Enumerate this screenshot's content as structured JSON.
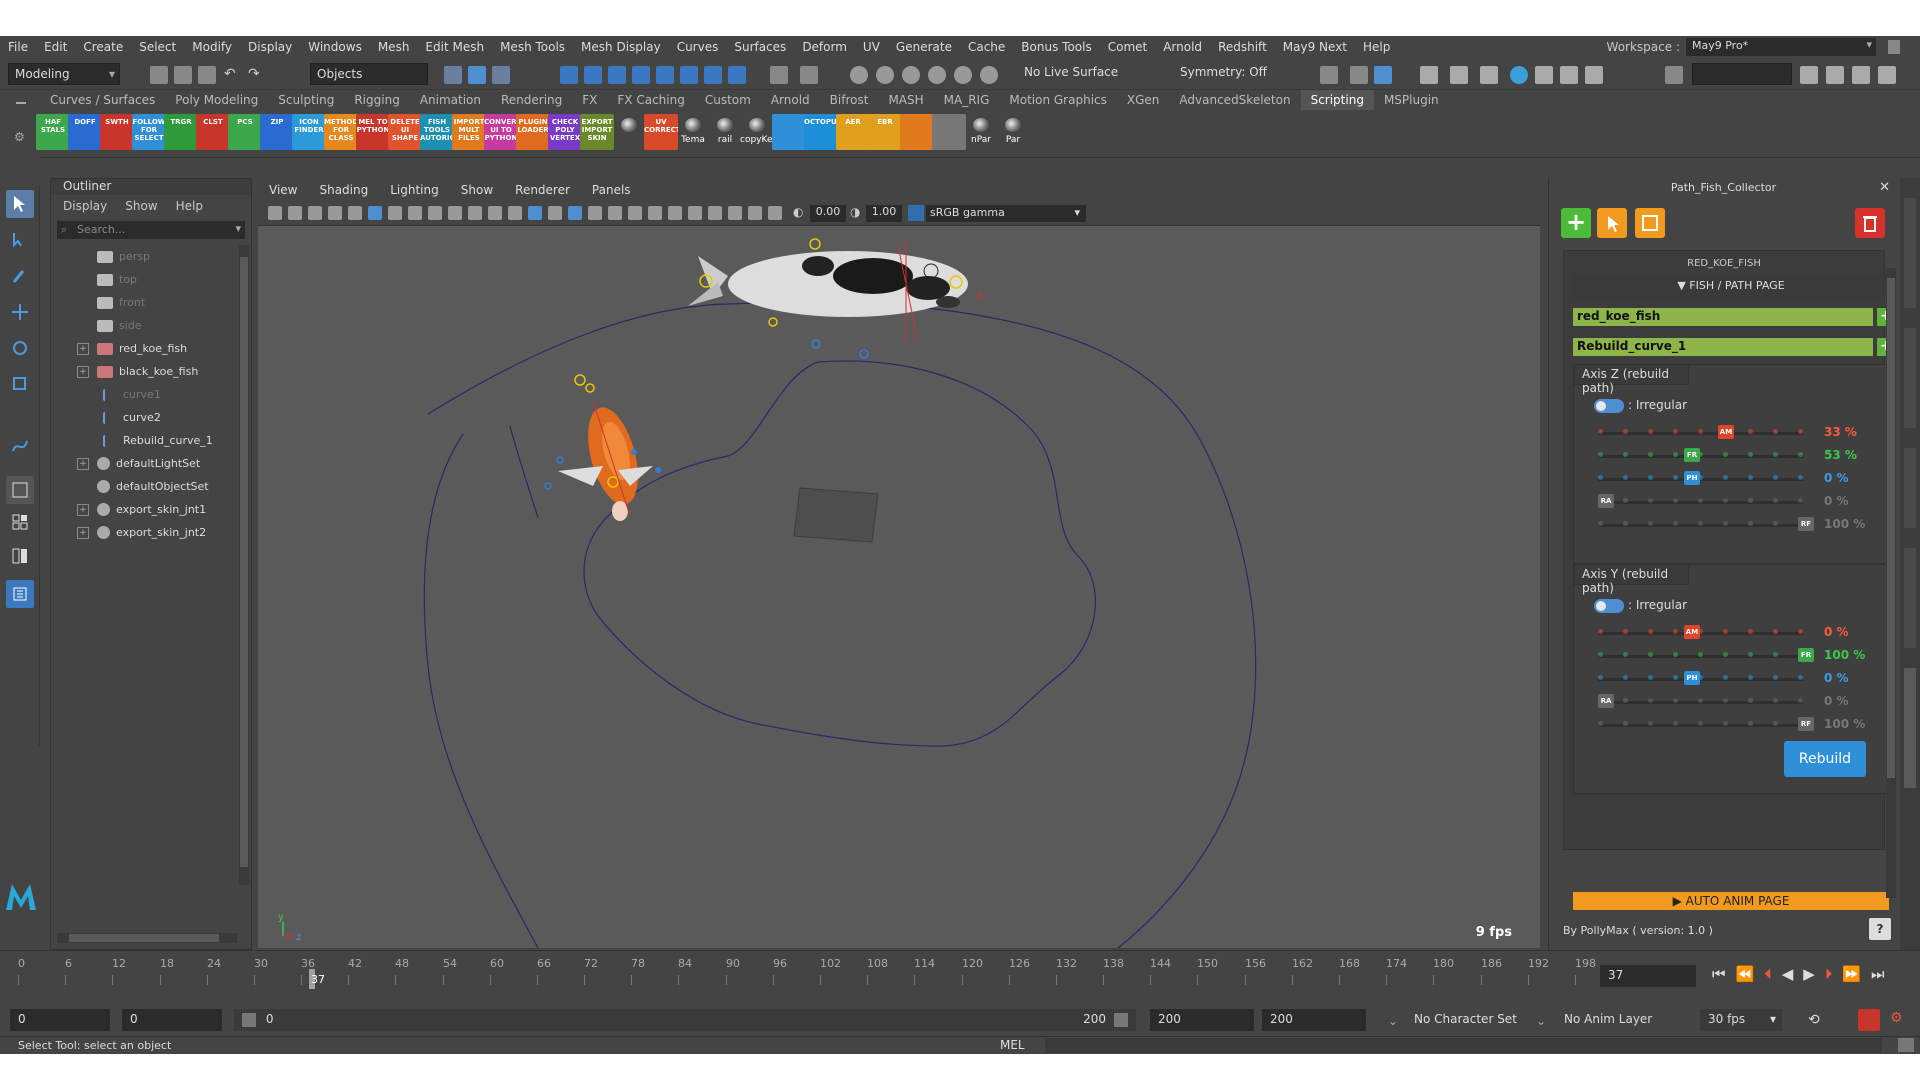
{
  "menubar": {
    "items": [
      "File",
      "Edit",
      "Create",
      "Select",
      "Modify",
      "Display",
      "Windows",
      "Mesh",
      "Edit Mesh",
      "Mesh Tools",
      "Mesh Display",
      "Curves",
      "Surfaces",
      "Deform",
      "UV",
      "Generate",
      "Cache",
      "Bonus Tools",
      "Comet",
      "Arnold",
      "Redshift",
      "May9 Next",
      "Help"
    ],
    "workspace_label": "Workspace :",
    "workspace_value": "May9 Pro*"
  },
  "status_line": {
    "mode": "Modeling",
    "selection": "Objects",
    "live_surface": "No Live Surface",
    "symmetry": "Symmetry: Off"
  },
  "shelf": {
    "tabs": [
      "Curves / Surfaces",
      "Poly Modeling",
      "Sculpting",
      "Rigging",
      "Animation",
      "Rendering",
      "FX",
      "FX Caching",
      "Custom",
      "Arnold",
      "Bifrost",
      "MASH",
      "MA_RIG",
      "Motion Graphics",
      "XGen",
      "AdvancedSkeleton",
      "Scripting",
      "MSPlugin"
    ],
    "active_tab": "Scripting",
    "buttons": [
      {
        "label": "HAF STALS",
        "color": "#3da84b"
      },
      {
        "label": "DOFF",
        "color": "#2a6bd1"
      },
      {
        "label": "SWTH",
        "color": "#c8352b"
      },
      {
        "label": "FOLLOW FOR SELECT",
        "color": "#2f8fd8"
      },
      {
        "label": "TRGR",
        "color": "#2f9a3a"
      },
      {
        "label": "CLST",
        "color": "#c8352b"
      },
      {
        "label": "PCS",
        "color": "#3da84b"
      },
      {
        "label": "ZIP",
        "color": "#2a6bd1"
      },
      {
        "label": "ICON FINDER",
        "color": "#2a9bd8"
      },
      {
        "label": "METHOD FOR CLASS",
        "color": "#e48a1d"
      },
      {
        "label": "MEL TO PYTHON",
        "color": "#c8352b"
      },
      {
        "label": "DELETE UI SHAPE",
        "color": "#e0532b"
      },
      {
        "label": "FISH TOOLS AUTORIG",
        "color": "#1d8fb3"
      },
      {
        "label": "IMPORT MULT FILES",
        "color": "#e07a1d"
      },
      {
        "label": "CONVERT UI TO PYTHON",
        "color": "#c83aa0"
      },
      {
        "label": "PLUGIN LOADER",
        "color": "#e06a1d"
      },
      {
        "label": "CHECK POLY VERTEX",
        "color": "#7a3ac8"
      },
      {
        "label": "EXPORT IMPORT SKIN",
        "color": "#6a8a2a"
      },
      {
        "label": "",
        "color": "ball"
      },
      {
        "label": "UV CORRECT",
        "color": "#d84a2a"
      },
      {
        "label": "Tema",
        "color": "ball"
      },
      {
        "label": "rail",
        "color": "ball"
      },
      {
        "label": "copyKey",
        "color": "ball"
      },
      {
        "label": "",
        "color": "#2f8fd8"
      },
      {
        "label": "OCTOPUS",
        "color": "#1d8fd8"
      },
      {
        "label": "AER",
        "color": "#e0a01d"
      },
      {
        "label": "EBR",
        "color": "#e0a01d"
      },
      {
        "label": "",
        "color": "#e07a1d"
      },
      {
        "label": "",
        "color": "#777"
      },
      {
        "label": "nPar",
        "color": "ball"
      },
      {
        "label": "Par",
        "color": "ball"
      }
    ]
  },
  "outliner": {
    "title": "Outliner",
    "menu": [
      "Display",
      "Show",
      "Help"
    ],
    "search_placeholder": "Search...",
    "items": [
      {
        "label": "persp",
        "icon": "camera-icon",
        "dim": true,
        "expandable": false
      },
      {
        "label": "top",
        "icon": "camera-icon",
        "dim": true,
        "expandable": false
      },
      {
        "label": "front",
        "icon": "camera-icon",
        "dim": true,
        "expandable": false
      },
      {
        "label": "side",
        "icon": "camera-icon",
        "dim": true,
        "expandable": false
      },
      {
        "label": "red_koe_fish",
        "icon": "mesh-icon",
        "dim": false,
        "expandable": true
      },
      {
        "label": "black_koe_fish",
        "icon": "mesh-icon",
        "dim": false,
        "expandable": true
      },
      {
        "label": "curve1",
        "icon": "curve-icon",
        "dim": true,
        "expandable": false
      },
      {
        "label": "curve2",
        "icon": "curve-icon",
        "dim": false,
        "expandable": false
      },
      {
        "label": "Rebuild_curve_1",
        "icon": "curve-icon",
        "dim": false,
        "expandable": false
      },
      {
        "label": "defaultLightSet",
        "icon": "set-icon",
        "dim": false,
        "expandable": true
      },
      {
        "label": "defaultObjectSet",
        "icon": "set-icon",
        "dim": false,
        "expandable": false
      },
      {
        "label": "export_skin_jnt1",
        "icon": "set-icon",
        "dim": false,
        "expandable": true
      },
      {
        "label": "export_skin_jnt2",
        "icon": "set-icon",
        "dim": false,
        "expandable": true
      }
    ]
  },
  "viewport": {
    "menu": [
      "View",
      "Shading",
      "Lighting",
      "Show",
      "Renderer",
      "Panels"
    ],
    "exposure": "0.00",
    "gamma": "1.00",
    "color_space": "sRGB gamma",
    "fps": "9 fps"
  },
  "fish_panel": {
    "title": "Path_Fish_Collector",
    "section_name": "RED_KOE_FISH",
    "page_label": "▼ FISH / PATH PAGE",
    "fish_name": "red_koe_fish",
    "curve_name": "Rebuild_curve_1",
    "axis_z": {
      "title": "Axis Z (rebuild path)",
      "mode": ": Irregular",
      "sliders": [
        {
          "tag": "AM",
          "tag_color": "#e0452b",
          "value": "33 %",
          "value_color": "#ff5a3a",
          "pos": 0.6
        },
        {
          "tag": "FR",
          "tag_color": "#3aa84b",
          "value": "53 %",
          "value_color": "#3ac84b",
          "pos": 0.43
        },
        {
          "tag": "PH",
          "tag_color": "#2f8fd8",
          "value": "0 %",
          "value_color": "#3a9be8",
          "pos": 0.43
        },
        {
          "tag": "RA",
          "tag_color": "#666",
          "value": "0 %",
          "value_color": "#777",
          "pos": 0.0
        },
        {
          "tag": "RF",
          "tag_color": "#666",
          "value": "100 %",
          "value_color": "#777",
          "pos": 1.0
        }
      ]
    },
    "axis_y": {
      "title": "Axis Y (rebuild path)",
      "mode": ": Irregular",
      "sliders": [
        {
          "tag": "AM",
          "tag_color": "#e0452b",
          "value": "0 %",
          "value_color": "#ff5a3a",
          "pos": 0.43
        },
        {
          "tag": "FR",
          "tag_color": "#3aa84b",
          "value": "100 %",
          "value_color": "#3ac84b",
          "pos": 1.0
        },
        {
          "tag": "PH",
          "tag_color": "#2f8fd8",
          "value": "0 %",
          "value_color": "#3a9be8",
          "pos": 0.43
        },
        {
          "tag": "RA",
          "tag_color": "#666",
          "value": "0 %",
          "value_color": "#777",
          "pos": 0.0
        },
        {
          "tag": "RF",
          "tag_color": "#666",
          "value": "100 %",
          "value_color": "#777",
          "pos": 1.0
        }
      ]
    },
    "rebuild_label": "Rebuild",
    "auto_anim_label": "▶ AUTO ANIM PAGE",
    "credit": "By PollyMax ( version: 1.0 )"
  },
  "timeline": {
    "ticks": [
      "0",
      "6",
      "12",
      "18",
      "24",
      "30",
      "36",
      "42",
      "48",
      "54",
      "60",
      "66",
      "72",
      "78",
      "84",
      "90",
      "96",
      "102",
      "108",
      "114",
      "120",
      "126",
      "132",
      "138",
      "144",
      "150",
      "156",
      "162",
      "168",
      "174",
      "180",
      "186",
      "192",
      "198"
    ],
    "current_frame": "37",
    "current_frame_box": "37"
  },
  "range": {
    "start": "0",
    "start_inner": "0",
    "slider_start": "0",
    "slider_end": "200",
    "end_inner": "200",
    "end": "200",
    "character_set": "No Character Set",
    "anim_layer": "No Anim Layer",
    "fps": "30 fps"
  },
  "status": {
    "help_line": "Select Tool: select an object",
    "mel_label": "MEL"
  }
}
